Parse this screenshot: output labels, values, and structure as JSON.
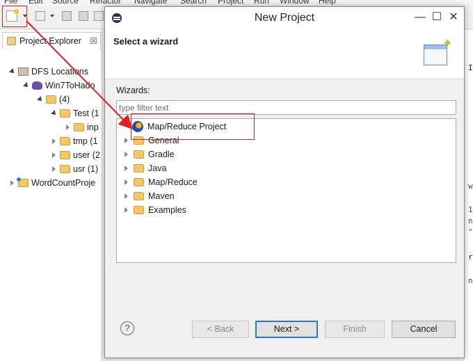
{
  "menu": [
    "File",
    "Edit",
    "Source",
    "Refactor",
    "Navigate",
    "Search",
    "Project",
    "Run",
    "Window",
    "Help"
  ],
  "explorer": {
    "tab_label": "Project Explorer",
    "tab_close": "☒",
    "tree": [
      {
        "label": "DFS Locations"
      },
      {
        "label": "Win7ToHado"
      },
      {
        "label": "(4)"
      },
      {
        "label": "Test (1"
      },
      {
        "label": "inp"
      },
      {
        "label": "tmp (1"
      },
      {
        "label": "user (2"
      },
      {
        "label": "usr (1)"
      },
      {
        "label": "WordCountProje"
      }
    ]
  },
  "dialog": {
    "title": "New Project",
    "minimize": "—",
    "maximize": "☐",
    "close": "✕",
    "heading": "Select a wizard",
    "wizards_label": "Wizards:",
    "filter_placeholder": "type filter text",
    "filter_value": "",
    "items": [
      {
        "label": "Map/Reduce Project"
      },
      {
        "label": "General"
      },
      {
        "label": "Gradle"
      },
      {
        "label": "Java"
      },
      {
        "label": "Map/Reduce"
      },
      {
        "label": "Maven"
      },
      {
        "label": "Examples"
      }
    ],
    "help": "?",
    "buttons": {
      "back": "< Back",
      "next": "Next >",
      "finish": "Finish",
      "cancel": "Cancel"
    }
  },
  "editor_fragments": [
    "I",
    "w",
    "1",
    "n",
    "\"",
    "r",
    "n"
  ],
  "colors": {
    "highlight": "#e02020",
    "default_button_border": "#2e74c9"
  }
}
